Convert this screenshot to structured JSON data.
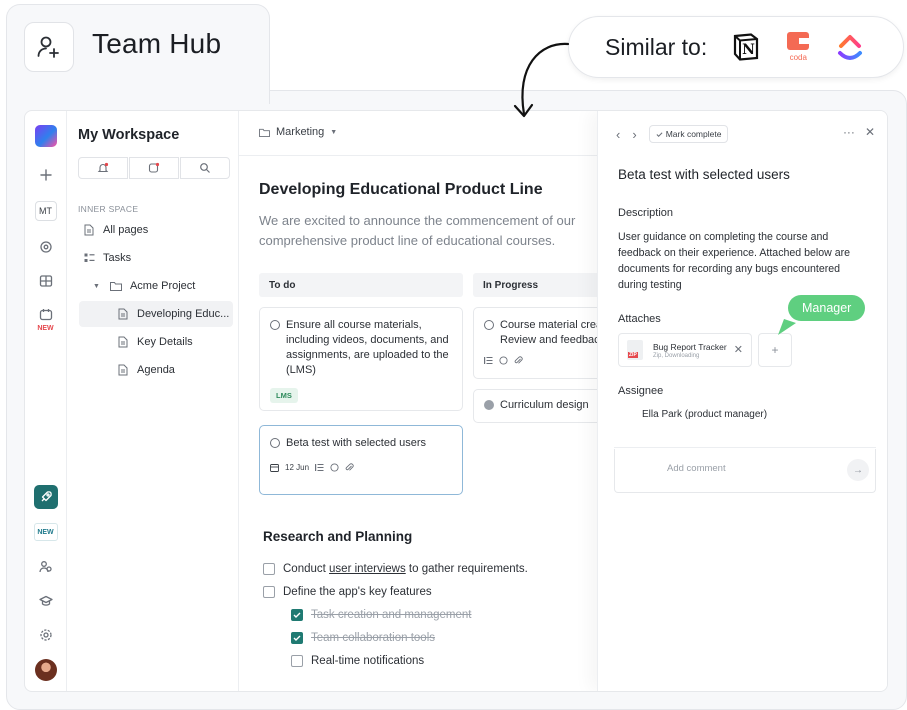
{
  "header": {
    "title": "Team Hub",
    "similar_label": "Similar to:",
    "logos": [
      "notion-logo",
      "coda-logo",
      "clickup-logo"
    ],
    "coda_text": "coda",
    "notion_letter": "N"
  },
  "rail": {
    "mt": "MT",
    "new_label": "NEW",
    "new_badge": "NEW"
  },
  "sidebar": {
    "workspace": "My Workspace",
    "inner_space": "INNER SPACE",
    "items": [
      "All pages",
      "Tasks",
      "Acme Project",
      "Developing Educ...",
      "Key Details",
      "Agenda"
    ]
  },
  "main": {
    "breadcrumb": "Marketing",
    "doc_title": "Developing Educational Product Line",
    "doc_desc": "We are excited to announce the commencement of our comprehensive product line of educational courses.",
    "columns": [
      {
        "name": "To do",
        "cards": [
          {
            "text": "Ensure all course materials, including videos, documents, and assignments, are uploaded to the (LMS)",
            "tag": "LMS"
          },
          {
            "text": "Beta test with selected users",
            "date": "12 Jun"
          }
        ]
      },
      {
        "name": "In Progress",
        "cards": [
          {
            "text": "Course material creation Review and feedback"
          },
          {
            "text": "Curriculum design"
          }
        ]
      }
    ],
    "section_title": "Research and Planning",
    "checklist": [
      {
        "pre": "Conduct ",
        "link": "user interviews",
        "post": " to gather requirements.",
        "checked": false
      },
      {
        "text": "Define the app's key features",
        "checked": false
      },
      {
        "text": "Task creation and management",
        "checked": true
      },
      {
        "text": "Team collaboration tools",
        "checked": true
      },
      {
        "text": "Real-time notifications",
        "checked": false
      }
    ]
  },
  "panel": {
    "mark_complete": "Mark complete",
    "title": "Beta test with selected users",
    "description_label": "Description",
    "description": "User guidance on completing the course and feedback on their experience. Attached below are documents for recording any bugs encountered during testing",
    "attaches_label": "Attaches",
    "attachment_name": "Bug Report Tracker",
    "attachment_sub": "Zip, Downloading",
    "manager_label": "Manager",
    "assignee_label": "Assignee",
    "assignee": "Ella Park (product manager)",
    "comment_placeholder": "Add comment"
  },
  "colors": {
    "accent_green": "#5fcf80",
    "check_teal": "#1f7a72",
    "lms_green": "#2d8a5b"
  }
}
